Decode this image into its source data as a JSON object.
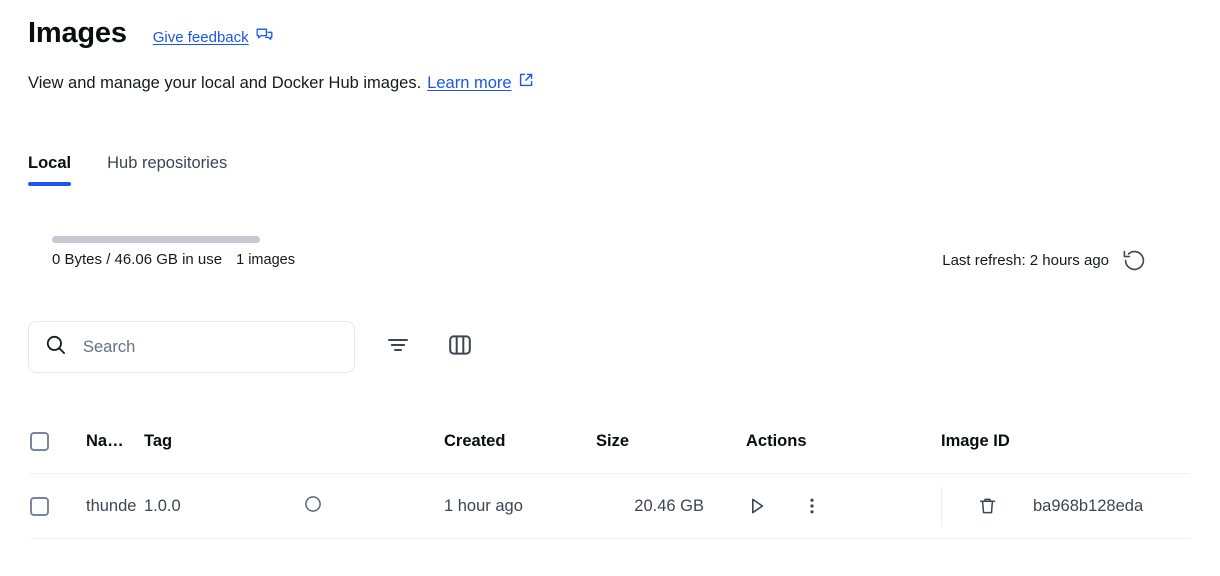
{
  "header": {
    "title": "Images",
    "feedback_label": "Give feedback",
    "feedback_icon": "feedback-bubbles-icon",
    "subtitle": "View and manage your local and Docker Hub images.",
    "learn_more_label": "Learn more",
    "learn_more_icon": "external-link-icon"
  },
  "tabs": [
    {
      "label": "Local",
      "active": true
    },
    {
      "label": "Hub repositories",
      "active": false
    }
  ],
  "usage": {
    "bar_percent": 0,
    "usage_text": "0 Bytes / 46.06 GB in use",
    "image_count": "1 images",
    "bar_color": "#c4c9d4"
  },
  "refresh": {
    "text": "Last refresh: 2 hours ago",
    "icon": "refresh-counterclockwise-icon"
  },
  "toolbar": {
    "search_placeholder": "Search",
    "search_value": "",
    "search_icon": "search-icon",
    "filter_icon": "filter-icon",
    "columns_icon": "columns-icon"
  },
  "table": {
    "columns": [
      "Na…",
      "Tag",
      "Created",
      "Size",
      "Actions",
      "Image ID"
    ],
    "rows": [
      {
        "name": "thunde",
        "tag": "1.0.0",
        "status_icon": "circle-outline-icon",
        "created": "1 hour ago",
        "size": "20.46 GB",
        "run_icon": "play-icon",
        "more_icon": "more-vertical-icon",
        "delete_icon": "trash-icon",
        "image_id": "ba968b128eda"
      }
    ]
  },
  "colors": {
    "accent": "#1a56f0",
    "link": "#1a56f0",
    "text": "#17191e",
    "muted": "#677285"
  }
}
